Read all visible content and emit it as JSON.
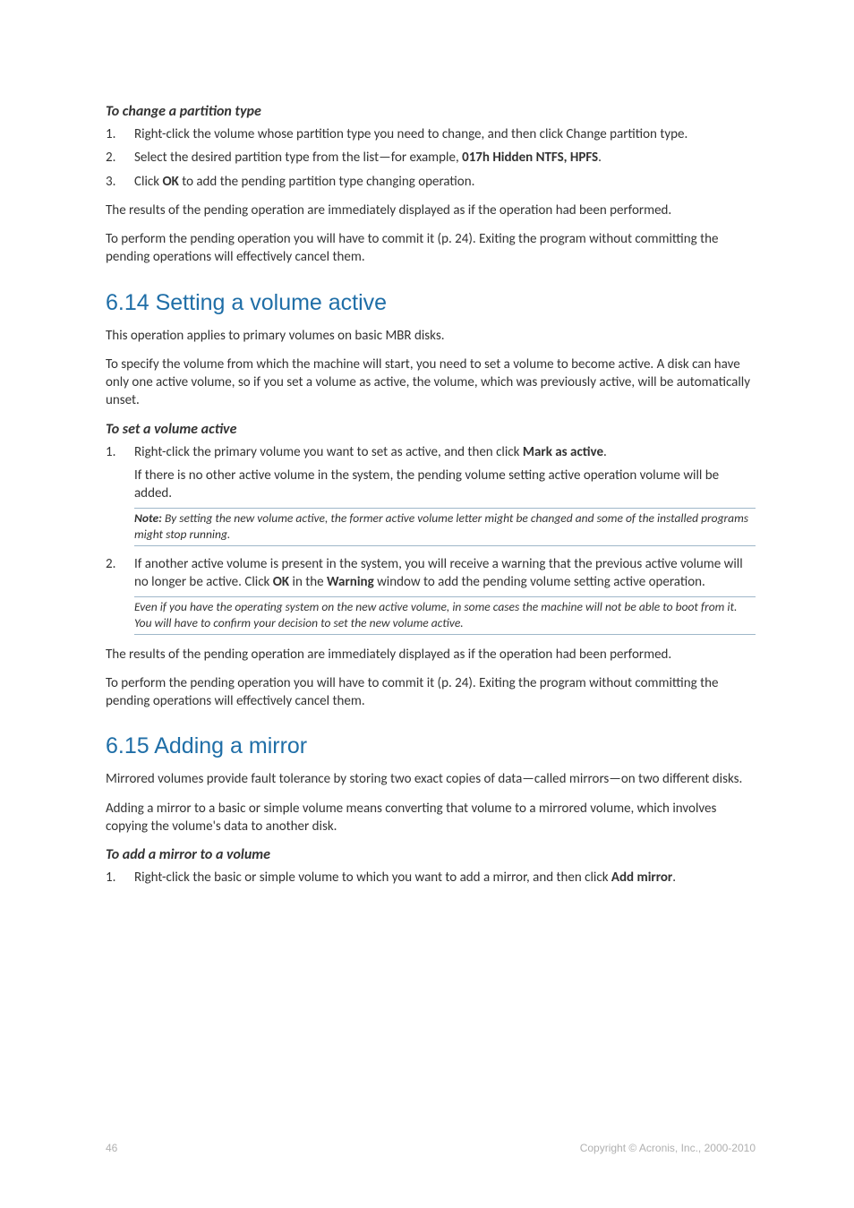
{
  "section_a": {
    "heading": "To change a partition type",
    "items": [
      "Right-click the volume whose partition type you need to change, and then click Change partition type.",
      "Select the desired partition type from the list—for example, <span class=\"bold\">017h Hidden NTFS, HPFS</span>.",
      "Click <span class=\"bold\">OK</span> to add the pending partition type changing operation."
    ],
    "para1": "The results of the pending operation are immediately displayed as if the operation had been performed.",
    "para2": "To perform the pending operation you will have to commit it (p. 24). Exiting the program without committing the pending operations will effectively cancel them."
  },
  "section_b": {
    "title": "6.14  Setting a volume active",
    "intro1": "This operation applies to primary volumes on basic MBR disks.",
    "intro2": "To specify the volume from which the machine will start, you need to set a volume to become active. A disk can have only one active volume, so if you set a volume as active, the volume, which was previously active, will be automatically unset.",
    "subheading": "To set a volume active",
    "item1_main": "Right-click the primary volume you want to set as active, and then click <span class=\"bold\">Mark as active</span>.",
    "item1_sub": "If there is no other active volume in the system, the pending volume setting active operation volume will be added.",
    "item1_note_label": "Note:",
    "item1_note_body": " By setting the new volume active, the former active volume letter might be changed and some of the installed programs might stop running.",
    "item2_main": "If another active volume is present in the system, you will receive a warning that the previous active volume will no longer be active. Click <span class=\"bold\">OK</span> in the <span class=\"bold\">Warning</span> window to add the pending volume setting active operation.",
    "item2_note": "Even if you have the operating system on the new active volume, in some cases the machine will not be able to boot from it. You will have to confirm your decision to set the new volume active.",
    "para1": "The results of the pending operation are immediately displayed as if the operation had been performed.",
    "para2": "To perform the pending operation you will have to commit it (p. 24). Exiting the program without committing the pending operations will effectively cancel them."
  },
  "section_c": {
    "title": "6.15  Adding a mirror",
    "intro1": "Mirrored volumes provide fault tolerance by storing two exact copies of data—called mirrors—on two different disks.",
    "intro2": "Adding a mirror to a basic or simple volume means converting that volume to a mirrored volume, which involves copying the volume's data to another disk.",
    "subheading": "To add a mirror to a volume",
    "item1": "Right-click the basic or simple volume to which you want to add a mirror, and then click <span class=\"bold\">Add mirror</span>."
  },
  "footer": {
    "page": "46",
    "copyright": "Copyright © Acronis, Inc., 2000-2010"
  }
}
